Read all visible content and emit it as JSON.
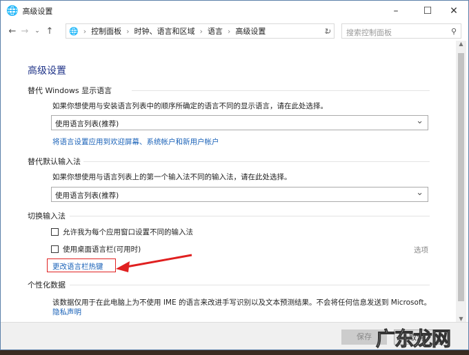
{
  "window": {
    "title": "高级设置",
    "minimize": "–",
    "maximize": "☐",
    "close": "✕"
  },
  "address": {
    "breadcrumbs": [
      "控制面板",
      "时钟、语言和区域",
      "语言",
      "高级设置"
    ],
    "search_placeholder": "搜索控制面板"
  },
  "page": {
    "title": "高级设置",
    "display_lang": {
      "heading": "替代 Windows 显示语言",
      "desc": "如果你想使用与安装语言列表中的顺序所确定的语言不同的显示语言，请在此处选择。",
      "select": "使用语言列表(推荐)",
      "link": "将语言设置应用到欢迎屏幕、系统帐户和新用户帐户"
    },
    "input_method": {
      "heading": "替代默认输入法",
      "desc": "如果你想使用与语言列表上的第一个输入法不同的输入法，请在此处选择。",
      "select": "使用语言列表(推荐)"
    },
    "switch_input": {
      "heading": "切换输入法",
      "checkbox1": "允许我为每个应用窗口设置不同的输入法",
      "checkbox2": "使用桌面语言栏(可用时)",
      "options": "选项",
      "hotkey_link": "更改语言栏热键"
    },
    "personal": {
      "heading": "个性化数据",
      "desc": "该数据仅用于在此电脑上为不使用 IME 的语言来改进手写识别以及文本预测结果。不会将任何信息发送到 Microsoft。",
      "privacy_link": "隐私声明"
    }
  },
  "footer": {
    "save": "保存",
    "cancel": "取消"
  },
  "watermark": "广东龙网",
  "colors": {
    "accent": "#1e3287",
    "link": "#1a62b8",
    "annotation": "#e02020"
  }
}
